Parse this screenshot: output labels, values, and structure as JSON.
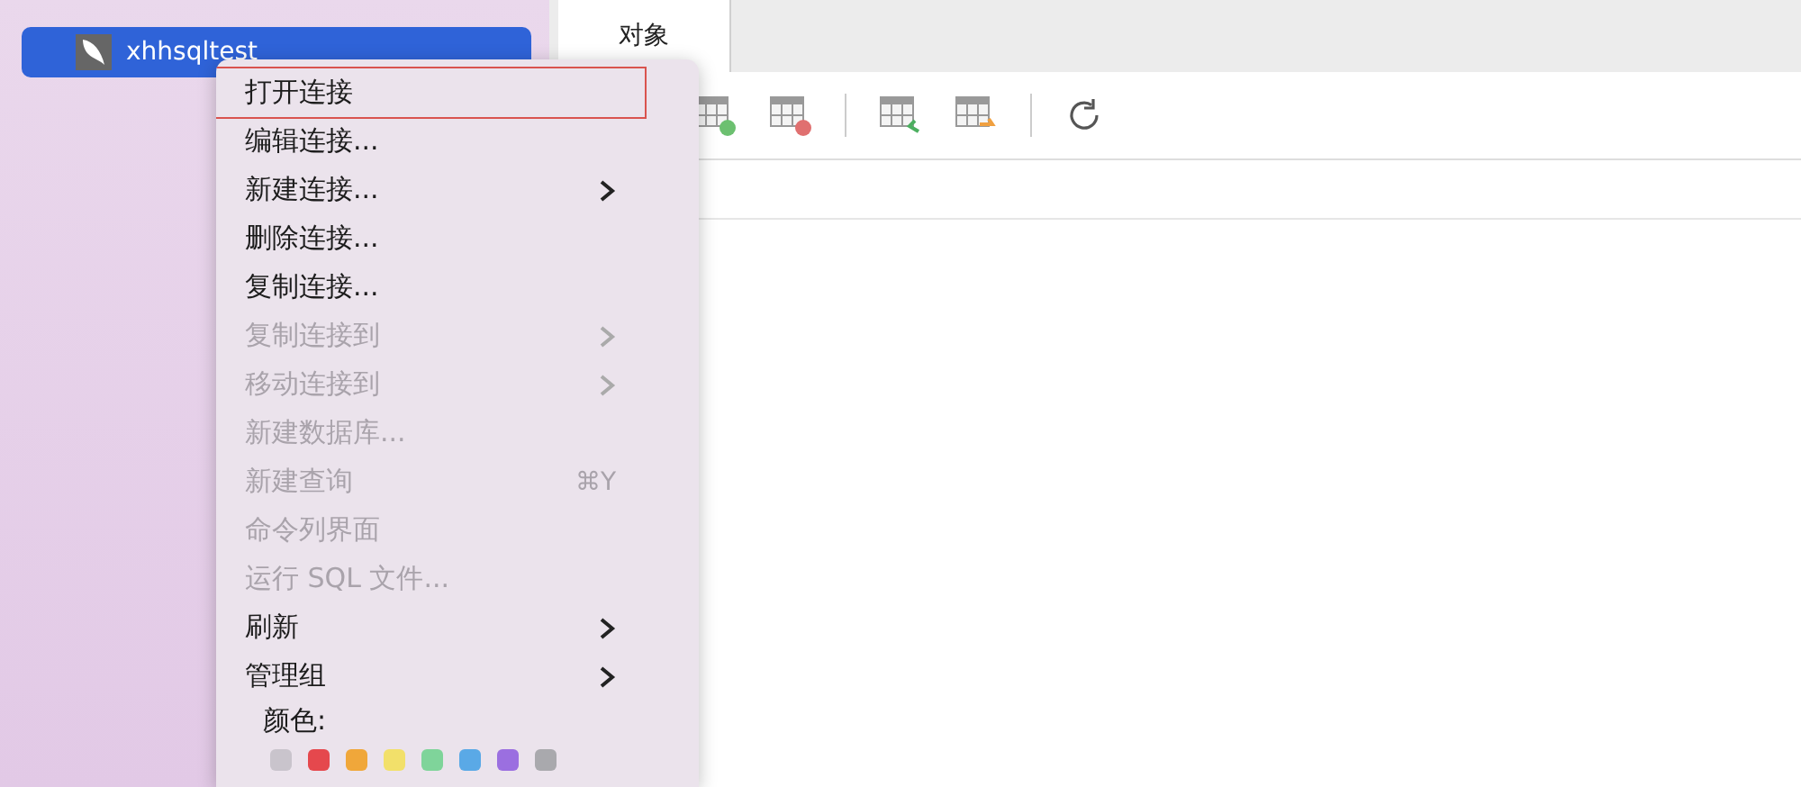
{
  "sidebar": {
    "items": [
      {
        "label": "xhhsqltest",
        "selected": true
      }
    ]
  },
  "tabs": [
    {
      "label": "对象",
      "selected": true
    }
  ],
  "context_menu": {
    "items": [
      {
        "label": "打开连接",
        "disabled": false,
        "submenu": false,
        "selected": true
      },
      {
        "label": "编辑连接...",
        "disabled": false,
        "submenu": false,
        "selected": false
      },
      {
        "label": "新建连接...",
        "disabled": false,
        "submenu": true,
        "selected": false
      },
      {
        "label": "删除连接...",
        "disabled": false,
        "submenu": false,
        "selected": false
      },
      {
        "label": "复制连接...",
        "disabled": false,
        "submenu": false,
        "selected": false
      },
      {
        "label": "复制连接到",
        "disabled": true,
        "submenu": true,
        "selected": false
      },
      {
        "label": "移动连接到",
        "disabled": true,
        "submenu": true,
        "selected": false
      },
      {
        "label": "新建数据库...",
        "disabled": true,
        "submenu": false,
        "selected": false
      },
      {
        "label": "新建查询",
        "disabled": true,
        "submenu": false,
        "shortcut": "⌘Y",
        "selected": false
      },
      {
        "label": "命令列界面",
        "disabled": true,
        "submenu": false,
        "selected": false
      },
      {
        "label": "运行 SQL 文件...",
        "disabled": true,
        "submenu": false,
        "selected": false
      },
      {
        "label": "刷新",
        "disabled": false,
        "submenu": true,
        "selected": false
      },
      {
        "label": "管理组",
        "disabled": false,
        "submenu": true,
        "selected": false
      }
    ],
    "color_label": "颜色:",
    "swatches": [
      {
        "color": "#c9c4cc"
      },
      {
        "color": "#e5484d"
      },
      {
        "color": "#f0a73a"
      },
      {
        "color": "#f2e06a"
      },
      {
        "color": "#7fd49a"
      },
      {
        "color": "#5aa9e6"
      },
      {
        "color": "#9b6fe0"
      },
      {
        "color": "#a9a9ad"
      }
    ]
  }
}
